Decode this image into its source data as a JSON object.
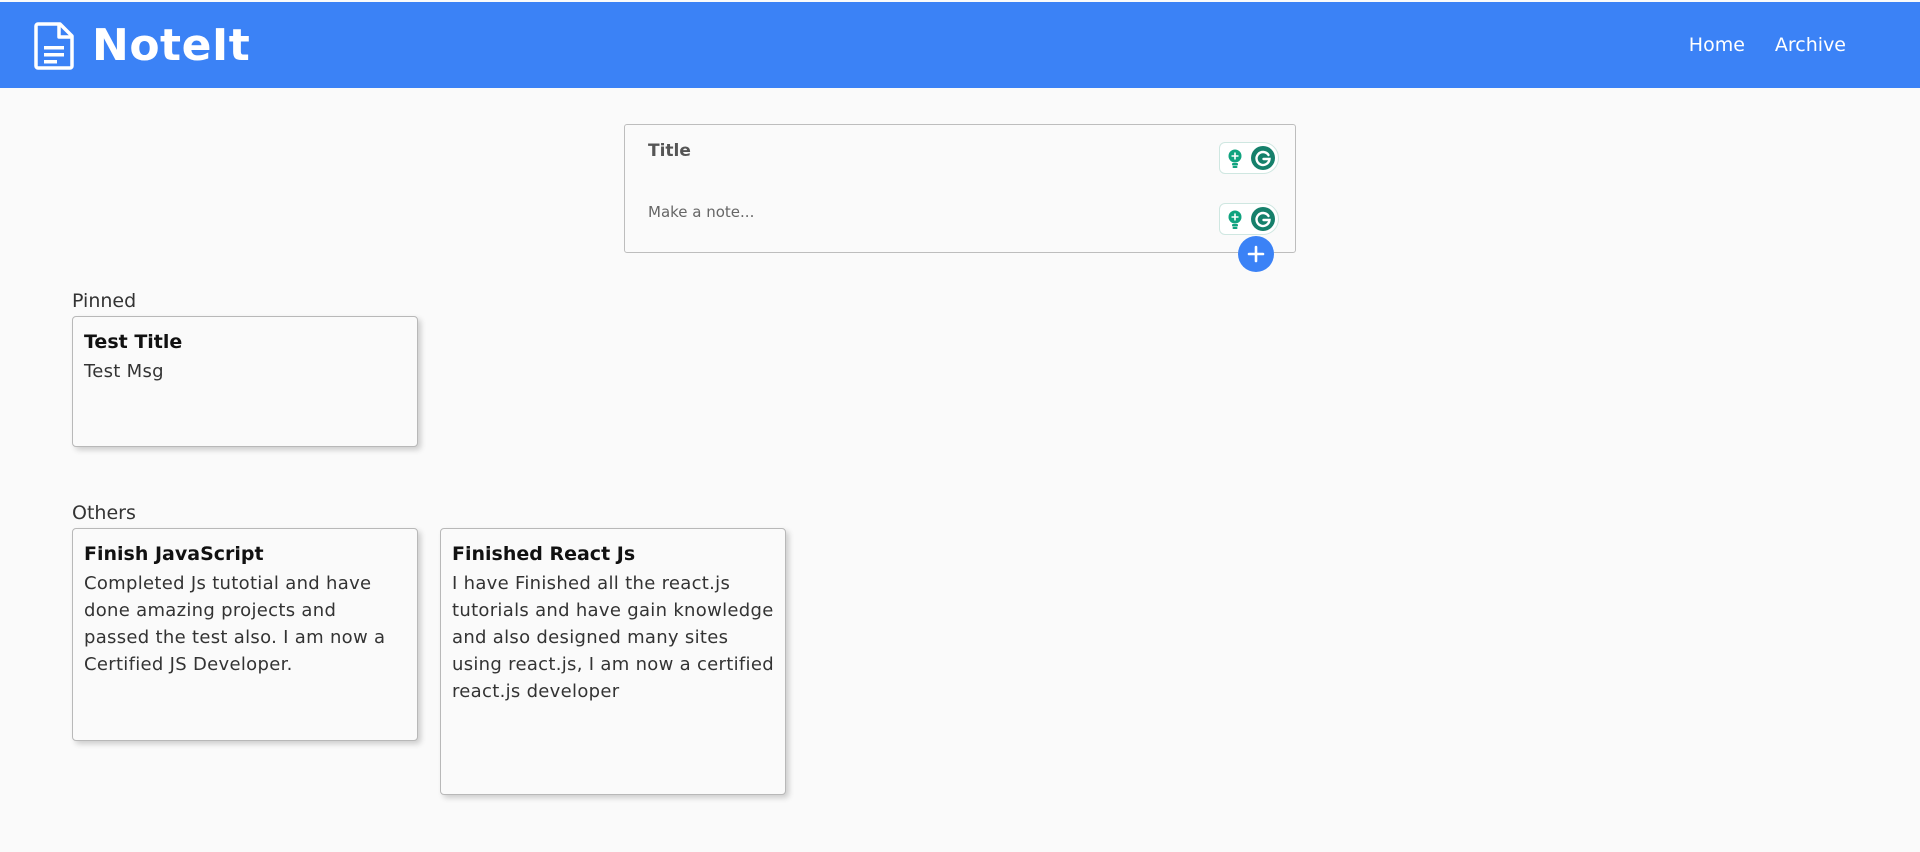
{
  "header": {
    "app_name": "NoteIt",
    "icon": "document-icon",
    "brand_color": "#3b82f6",
    "nav": [
      {
        "label": "Home"
      },
      {
        "label": "Archive"
      }
    ]
  },
  "composer": {
    "title_placeholder": "Title",
    "title_value": "",
    "note_placeholder": "Make a note...",
    "note_value": "",
    "add_icon": "plus-icon",
    "extension_icons": [
      "lightbulb-icon",
      "grammarly-icon"
    ]
  },
  "pinned": {
    "label": "Pinned",
    "notes": [
      {
        "title": "Test Title",
        "content": "Test Msg"
      }
    ]
  },
  "others": {
    "label": "Others",
    "notes": [
      {
        "title": "Finish JavaScript",
        "content": "Completed Js tutotial and have done amazing projects and passed the test also. I am now a Certified JS Developer."
      },
      {
        "title": "Finished React Js",
        "content": "I have Finished all the react.js tutorials and have gain knowledge and also designed many sites using react.js, I am now a certified react.js developer"
      }
    ]
  }
}
